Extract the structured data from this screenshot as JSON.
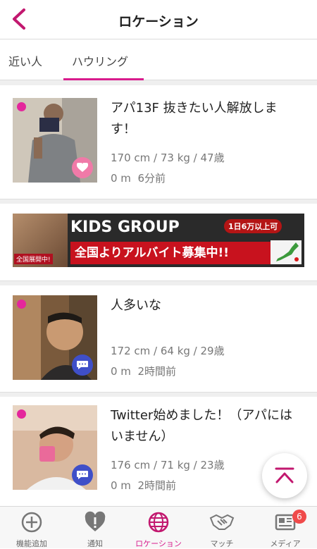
{
  "header": {
    "title": "ロケーション",
    "back_icon": "chevron-left-icon"
  },
  "tabs": [
    {
      "label": "近い人",
      "active": false
    },
    {
      "label": "ハウリング",
      "active": true
    }
  ],
  "posts": [
    {
      "message": "アパ13F 抜きたい人解放します！",
      "stats": "170 cm / 73 kg / 47歳",
      "distance": "0 m",
      "time": "6分前",
      "badge_icon": "heart-icon"
    },
    {
      "message": "人多いな",
      "stats": "172 cm / 64 kg / 29歳",
      "distance": "0 m",
      "time": "2時間前",
      "badge_icon": "chat-bubble-icon"
    },
    {
      "message": "Twitter始めました！（アパにはいません）",
      "stats": "176 cm / 71 kg / 23歳",
      "distance": "0 m",
      "time": "2時間前",
      "badge_icon": "chat-bubble-icon"
    }
  ],
  "ad": {
    "brand": "KIDS GROUP",
    "pill": "1日6万以上可",
    "headline": "全国よりアルバイト募集中!!",
    "face_tag": "全国展開中!"
  },
  "tabbar": [
    {
      "label": "機能追加",
      "icon": "plus-circle-icon"
    },
    {
      "label": "通知",
      "icon": "heart-alert-icon"
    },
    {
      "label": "ロケーション",
      "icon": "globe-icon",
      "active": true
    },
    {
      "label": "マッチ",
      "icon": "handshake-icon"
    },
    {
      "label": "メディア",
      "icon": "newspaper-icon",
      "badge": "6"
    }
  ],
  "colors": {
    "accent": "#d81b8c",
    "online": "#e4279c",
    "badge_red": "#f04a4a"
  }
}
